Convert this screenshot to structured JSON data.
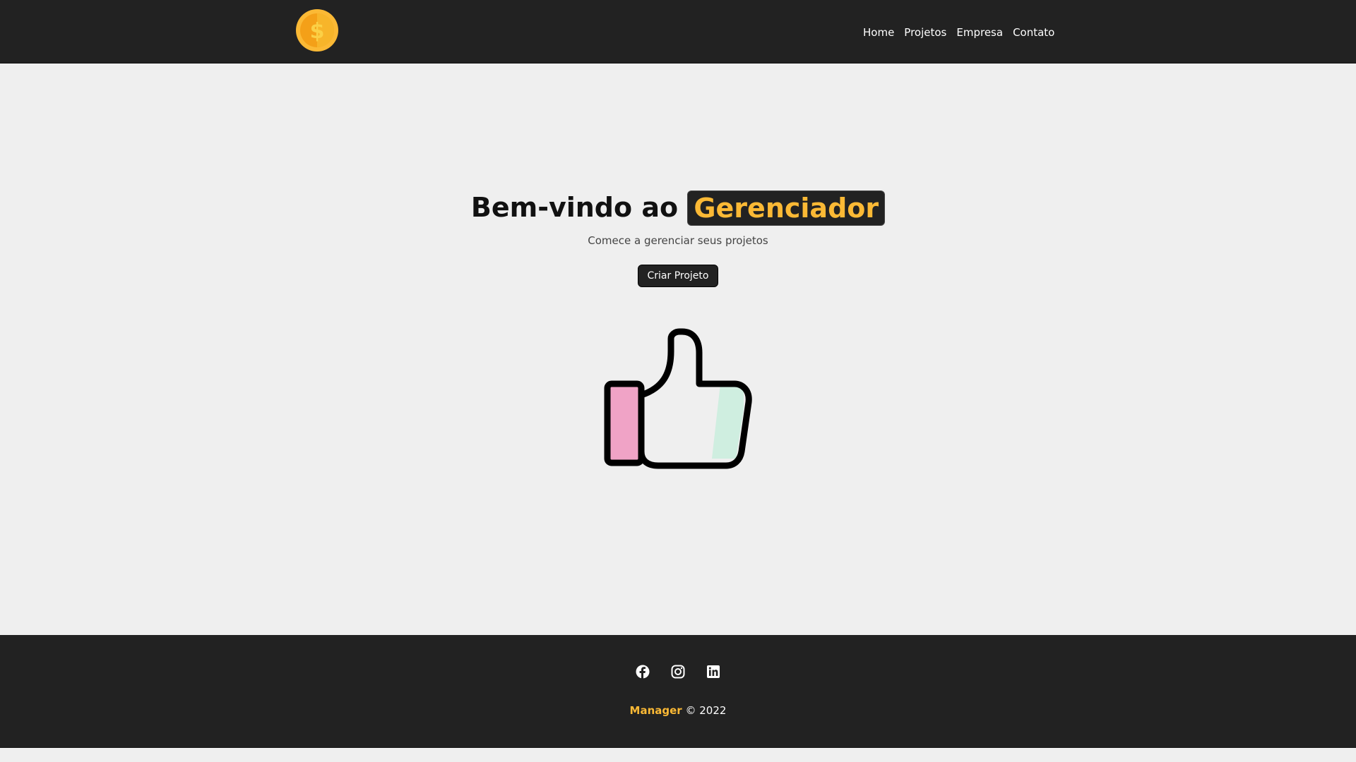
{
  "navbar": {
    "logo_icon": "dollar-coin-icon",
    "links": [
      {
        "label": "Home"
      },
      {
        "label": "Projetos"
      },
      {
        "label": "Empresa"
      },
      {
        "label": "Contato"
      }
    ]
  },
  "hero": {
    "title_prefix": "Bem-vindo ao",
    "title_highlight": "Gerenciador",
    "subtitle": "Comece a gerenciar seus projetos",
    "cta_label": "Criar Projeto",
    "illustration_icon": "thumbs-up-icon"
  },
  "footer": {
    "social_icons": [
      "facebook-icon",
      "instagram-icon",
      "linkedin-icon"
    ],
    "brand": "Manager",
    "copyright": "© 2022"
  },
  "colors": {
    "dark": "#222222",
    "accent": "#fbb935",
    "background": "#efefef",
    "thumb_cuff": "#f0a3c6",
    "thumb_highlight": "#cfeee0"
  }
}
